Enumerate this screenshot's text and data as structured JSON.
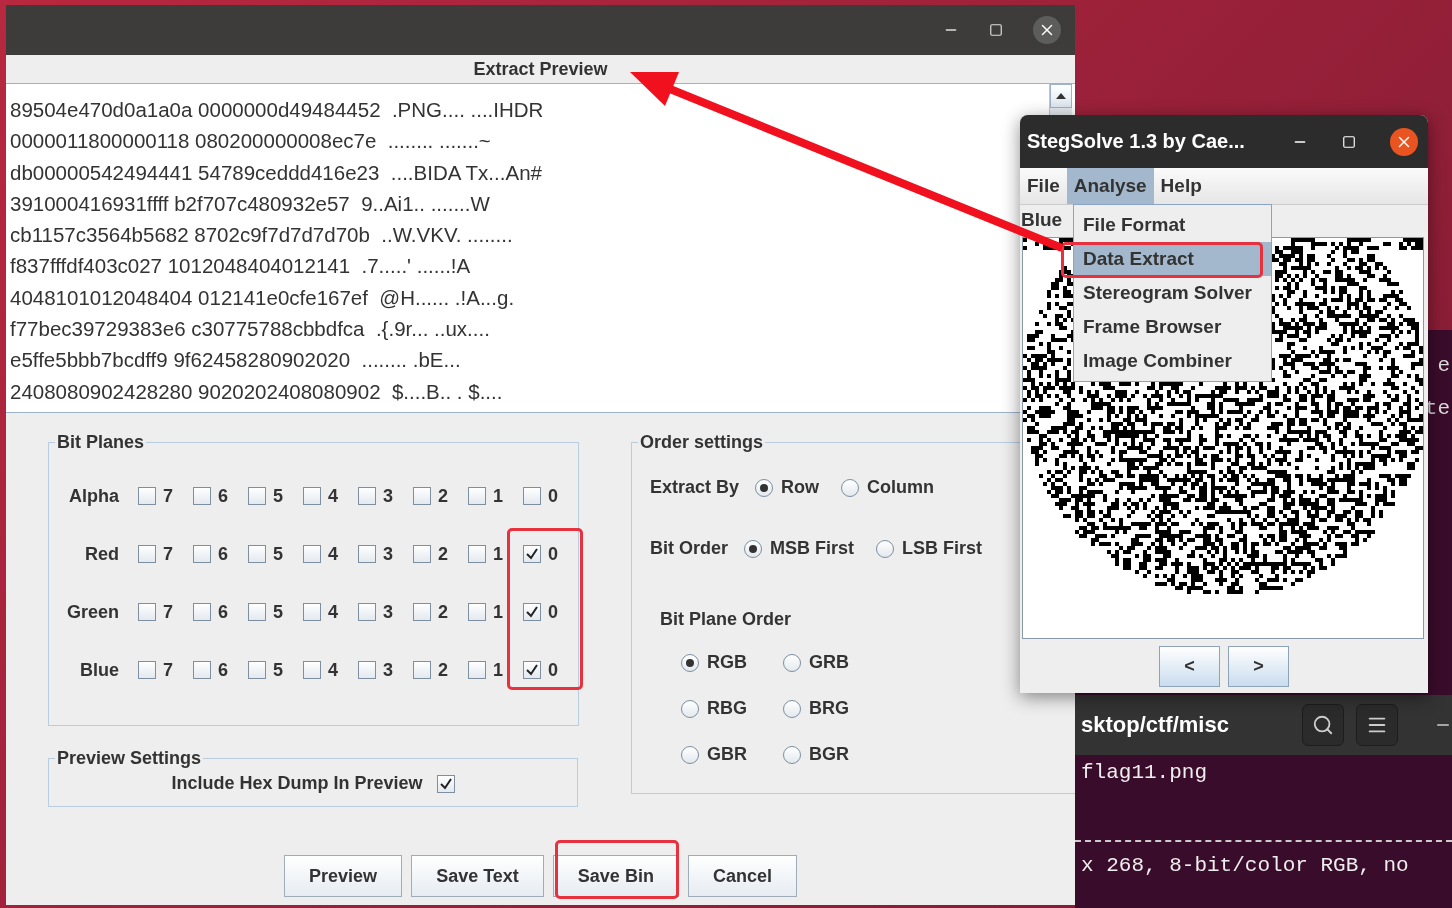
{
  "extract_window": {
    "title": "Extract Preview",
    "hex_lines": [
      "89504e470d0a1a0a 0000000d49484452  .PNG.... ....IHDR",
      "0000011800000118 080200000008ec7e  ........ .......~",
      "db00000542494441 54789ceddd416e23  ....BIDA Tx...An#",
      "391000416931ffff b2f707c480932e57  9..Ai1.. .......W",
      "cb1157c3564b5682 8702c9f7d7d7d70b  ..W.VKV. ........",
      "f837fffdf403c027 1012048404012141  .7.....' ......!A",
      "4048101012048404 012141e0cfe167ef  @H...... .!A...g.",
      "f77bec39729383e6 c30775788cbbdfca  .{.9r... ..ux....",
      "e5ffe5bbb7bcdff9 9f62458280902020  ........ .bE...  ",
      "2408080902428280 9020202408080902  $....B.. . $...."
    ],
    "bit_planes": {
      "title": "Bit Planes",
      "rows": [
        {
          "label": "Alpha",
          "bits": [
            {
              "label": "7",
              "checked": false
            },
            {
              "label": "6",
              "checked": false
            },
            {
              "label": "5",
              "checked": false
            },
            {
              "label": "4",
              "checked": false
            },
            {
              "label": "3",
              "checked": false
            },
            {
              "label": "2",
              "checked": false
            },
            {
              "label": "1",
              "checked": false
            },
            {
              "label": "0",
              "checked": false
            }
          ]
        },
        {
          "label": "Red",
          "bits": [
            {
              "label": "7",
              "checked": false
            },
            {
              "label": "6",
              "checked": false
            },
            {
              "label": "5",
              "checked": false
            },
            {
              "label": "4",
              "checked": false
            },
            {
              "label": "3",
              "checked": false
            },
            {
              "label": "2",
              "checked": false
            },
            {
              "label": "1",
              "checked": false
            },
            {
              "label": "0",
              "checked": true
            }
          ]
        },
        {
          "label": "Green",
          "bits": [
            {
              "label": "7",
              "checked": false
            },
            {
              "label": "6",
              "checked": false
            },
            {
              "label": "5",
              "checked": false
            },
            {
              "label": "4",
              "checked": false
            },
            {
              "label": "3",
              "checked": false
            },
            {
              "label": "2",
              "checked": false
            },
            {
              "label": "1",
              "checked": false
            },
            {
              "label": "0",
              "checked": true
            }
          ]
        },
        {
          "label": "Blue",
          "bits": [
            {
              "label": "7",
              "checked": false
            },
            {
              "label": "6",
              "checked": false
            },
            {
              "label": "5",
              "checked": false
            },
            {
              "label": "4",
              "checked": false
            },
            {
              "label": "3",
              "checked": false
            },
            {
              "label": "2",
              "checked": false
            },
            {
              "label": "1",
              "checked": false
            },
            {
              "label": "0",
              "checked": true
            }
          ]
        }
      ]
    },
    "preview_settings": {
      "title": "Preview Settings",
      "option": {
        "label": "Include Hex Dump In Preview",
        "checked": true
      }
    },
    "order_settings": {
      "title": "Order settings",
      "extract_by": {
        "label": "Extract By",
        "options": [
          {
            "label": "Row",
            "selected": true
          },
          {
            "label": "Column",
            "selected": false
          }
        ]
      },
      "bit_order": {
        "label": "Bit Order",
        "options": [
          {
            "label": "MSB First",
            "selected": true
          },
          {
            "label": "LSB First",
            "selected": false
          }
        ]
      },
      "bit_plane_order": {
        "label": "Bit Plane Order",
        "options": [
          {
            "label": "RGB",
            "selected": true
          },
          {
            "label": "GRB",
            "selected": false
          },
          {
            "label": "RBG",
            "selected": false
          },
          {
            "label": "BRG",
            "selected": false
          },
          {
            "label": "GBR",
            "selected": false
          },
          {
            "label": "BGR",
            "selected": false
          }
        ]
      }
    },
    "buttons": [
      "Preview",
      "Save Text",
      "Save Bin",
      "Cancel"
    ]
  },
  "stegsolve": {
    "title": "StegSolve 1.3 by Cae...",
    "menus": [
      {
        "label": "File",
        "selected": false
      },
      {
        "label": "Analyse",
        "selected": true
      },
      {
        "label": "Help",
        "selected": false
      }
    ],
    "plane_label": "Blue",
    "menu_items": [
      {
        "label": "File Format",
        "selected": false
      },
      {
        "label": "Data Extract",
        "selected": true
      },
      {
        "label": "Stereogram Solver",
        "selected": false
      },
      {
        "label": "Frame Browser",
        "selected": false
      },
      {
        "label": "Image Combiner",
        "selected": false
      }
    ],
    "nav_buttons": [
      "<",
      ">"
    ]
  },
  "terminal": {
    "edge_texts": [
      "e",
      "te"
    ],
    "path": "sktop/ctf/misc",
    "lines": [
      "flag11.png",
      "x 268, 8-bit/color RGB, no"
    ]
  }
}
